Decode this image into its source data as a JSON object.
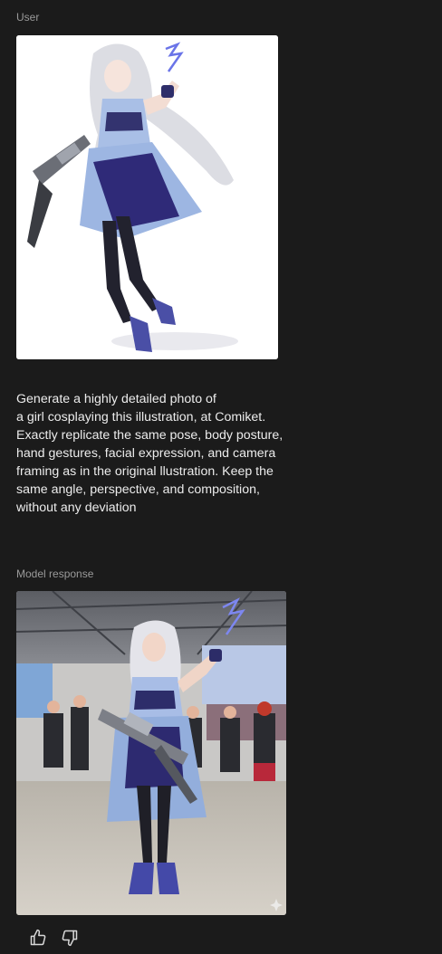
{
  "conversation": {
    "user_label": "User",
    "model_label": "Model response",
    "prompt_lines": [
      "Generate a highly detailed photo of",
      "a girl cosplaying this illustration, at Comiket.",
      "Exactly replicate the same pose, body posture,",
      "hand gestures, facial expression, and camera",
      "framing as in the original llustration. Keep the",
      "same angle, perspective, and composition,",
      "without any deviation"
    ]
  },
  "icons": {
    "thumbs_up": "thumbs-up-icon",
    "thumbs_down": "thumbs-down-icon",
    "sparkle": "sparkle-icon"
  },
  "colors": {
    "background": "#1b1b1b",
    "label": "#9a9a9a",
    "text": "#ececec",
    "costume_blue": "#8fa8d8",
    "costume_navy": "#2d2a6e"
  }
}
